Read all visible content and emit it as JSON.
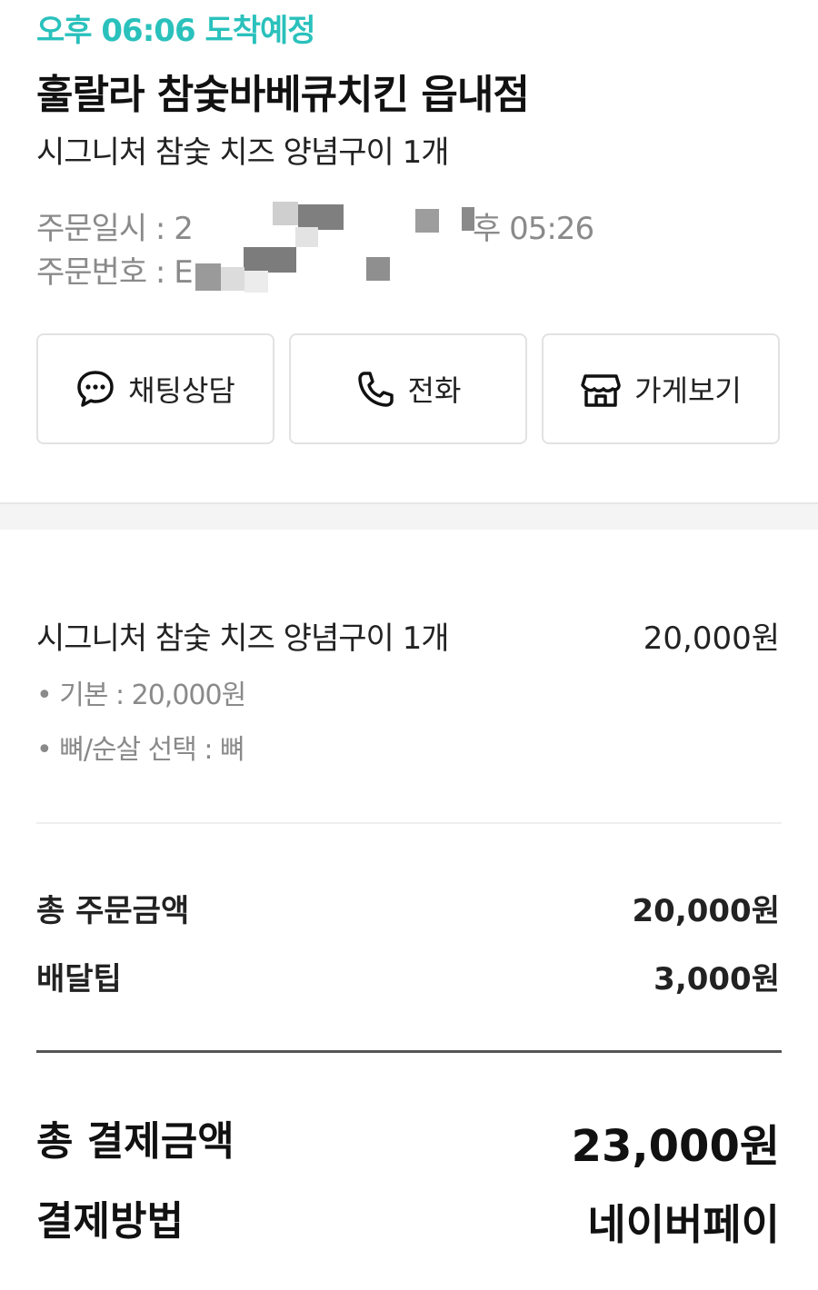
{
  "header": {
    "eta": "오후 06:06 도착예정",
    "store_name": "훌랄라 참숯바베큐치킨 읍내점",
    "menu_summary": "시그니처 참숯 치즈 양념구이 1개",
    "order_date_label": "주문일시 : 2",
    "order_date_tail": "후 05:26",
    "order_number_label": "주문번호 : E"
  },
  "actions": {
    "chat_label": "채팅상담",
    "call_label": "전화",
    "store_label": "가게보기"
  },
  "order_item": {
    "name": "시그니처 참숯 치즈 양념구이 1개",
    "price": "20,000원",
    "options": [
      "• 기본 : 20,000원",
      "• 뼈/순살 선택 : 뼈"
    ]
  },
  "summary": {
    "order_total_label": "총 주문금액",
    "order_total_value": "20,000원",
    "delivery_tip_label": "배달팁",
    "delivery_tip_value": "3,000원",
    "payment_total_label": "총 결제금액",
    "payment_total_value": "23,000원",
    "payment_method_label": "결제방법",
    "payment_method_value": "네이버페이"
  },
  "colors": {
    "accent": "#2ac1bc",
    "text": "#222222",
    "muted": "#8a8a8a",
    "border": "#e2e2e2"
  },
  "icons": [
    "chat-icon",
    "phone-icon",
    "store-icon"
  ]
}
